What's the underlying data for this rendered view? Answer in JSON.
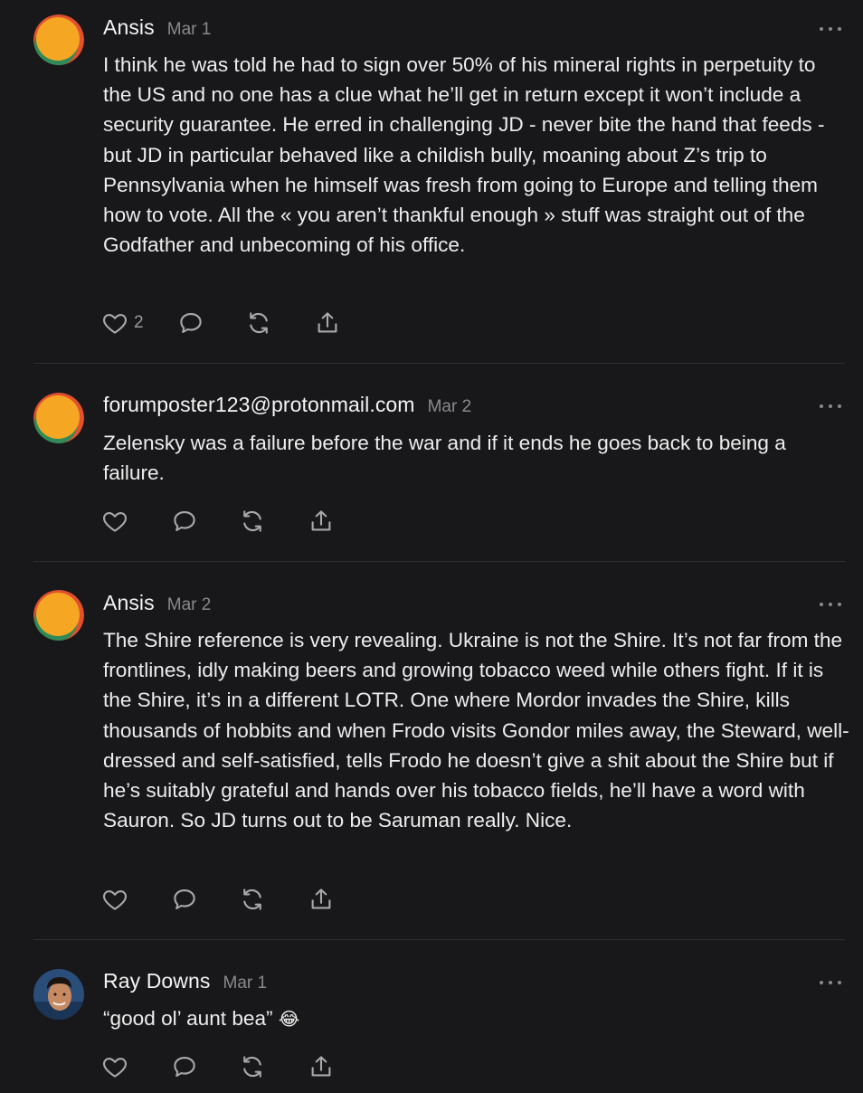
{
  "comments": [
    {
      "author": "Ansis",
      "date": "Mar 1",
      "text": "I think he was told he had to sign over 50% of his mineral rights in perpetuity to the US and no one has a clue what he’ll get in return except it won’t include a security guarantee. He erred in challenging JD - never bite the hand that feeds - but JD in particular behaved like a childish bully, moaning about Z’s trip to Pennsylvania when he himself was fresh from going to Europe and telling them how to vote. All the « you aren’t thankful enough » stuff was straight out of the Godfather and unbecoming of his office.",
      "likes": "2"
    },
    {
      "author": "forumposter123@protonmail.com",
      "date": "Mar 2",
      "text": "Zelensky was a failure before the war and if it ends he goes back to being a failure."
    },
    {
      "author": "Ansis",
      "date": "Mar 2",
      "text": "The Shire reference is very revealing. Ukraine is not the Shire. It’s not far from the frontlines, idly making beers and growing tobacco weed while others fight. If it is the Shire, it’s in a different LOTR. One where Mordor invades the Shire, kills thousands of hobbits and when Frodo visits Gondor miles away, the Steward, well-dressed and self-satisfied, tells Frodo he doesn’t give a shit about the Shire but if he’s suitably grateful and hands over his tobacco fields, he’ll have a word with Sauron. So JD turns out to be Saruman really. Nice."
    },
    {
      "author": "Ray Downs",
      "date": "Mar 1",
      "text": "“good ol’ aunt bea”",
      "emoji": "😂"
    }
  ],
  "icons": {
    "like": "heart-icon",
    "reply": "comment-bubble-icon",
    "restack": "restack-icon",
    "share": "share-icon",
    "more": "more-dots-icon"
  },
  "colors": {
    "background": "#18181a",
    "text": "#ededed",
    "muted": "#8a8a8e",
    "divider": "#2e2e31",
    "avatar_orange": "#f5a623",
    "avatar_red": "#e2502f",
    "avatar_green": "#2f8a57"
  }
}
